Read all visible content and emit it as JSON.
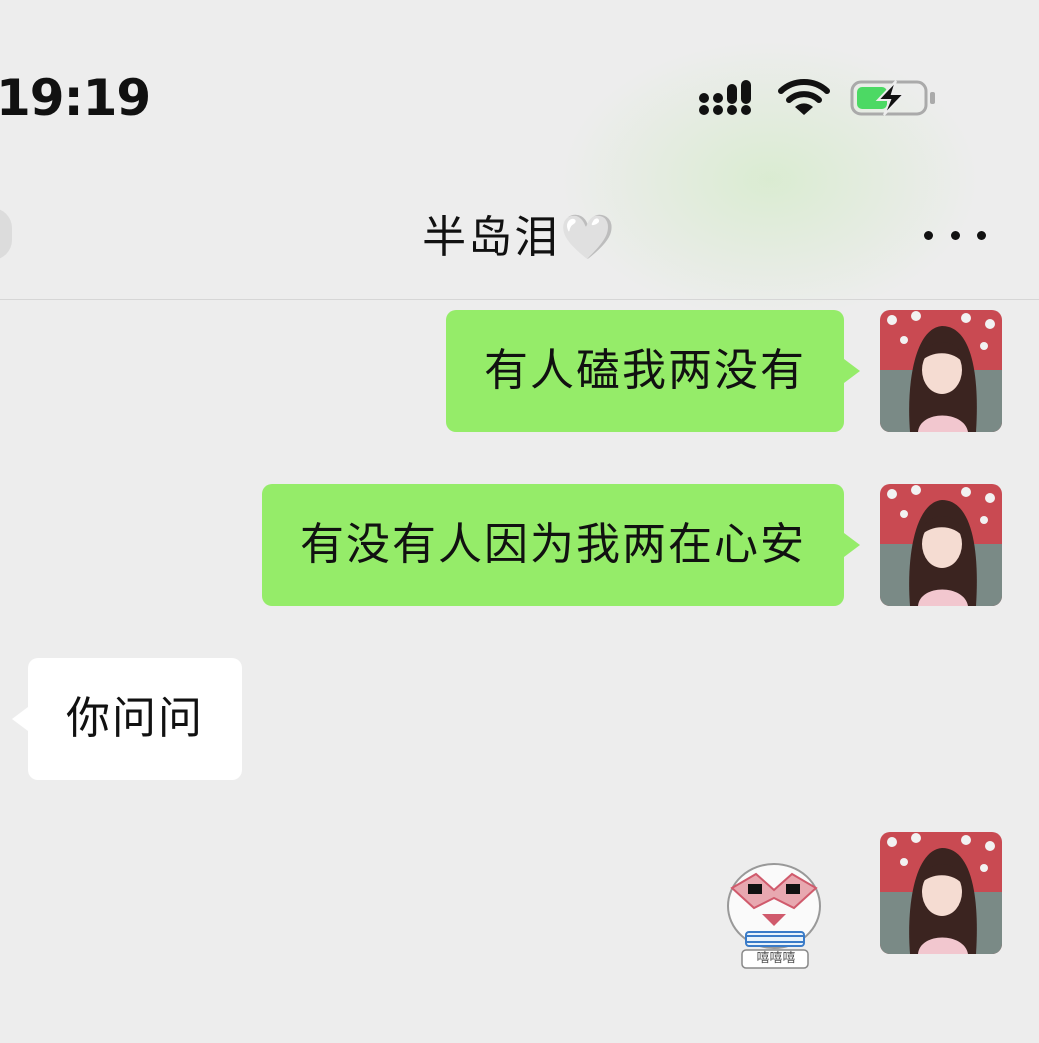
{
  "status_bar": {
    "time": "19:19",
    "signal_icon": "cellular-signal-icon",
    "wifi_icon": "wifi-icon",
    "battery_icon": "battery-charging-icon",
    "battery_color": "#4cd964"
  },
  "nav": {
    "back_icon": "back-button",
    "title": "半岛泪🤍",
    "more_icon": "more-dots-icon"
  },
  "colors": {
    "sent_bubble": "#95ec69",
    "received_bubble": "#ffffff",
    "background": "#ededed"
  },
  "messages": [
    {
      "direction": "sent",
      "type": "text",
      "text": "有人磕我两没有"
    },
    {
      "direction": "sent",
      "type": "text",
      "text": "有没有人因为我两在心安"
    },
    {
      "direction": "received",
      "type": "text",
      "text": "你问问"
    },
    {
      "direction": "sent",
      "type": "sticker",
      "sticker": "cartoon-sticker-icon",
      "sticker_caption": "嘻嘻嘻"
    }
  ]
}
